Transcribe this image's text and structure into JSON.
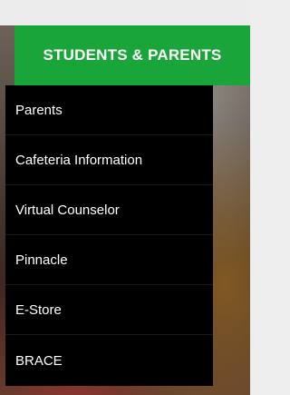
{
  "nav": {
    "tab_label": "STUDENTS & PARENTS",
    "tab_color": "#19a53a",
    "items": [
      {
        "label": "Parents"
      },
      {
        "label": "Cafeteria Information"
      },
      {
        "label": "Virtual Counselor"
      },
      {
        "label": "Pinnacle"
      },
      {
        "label": "E-Store"
      },
      {
        "label": "BRACE"
      }
    ]
  }
}
